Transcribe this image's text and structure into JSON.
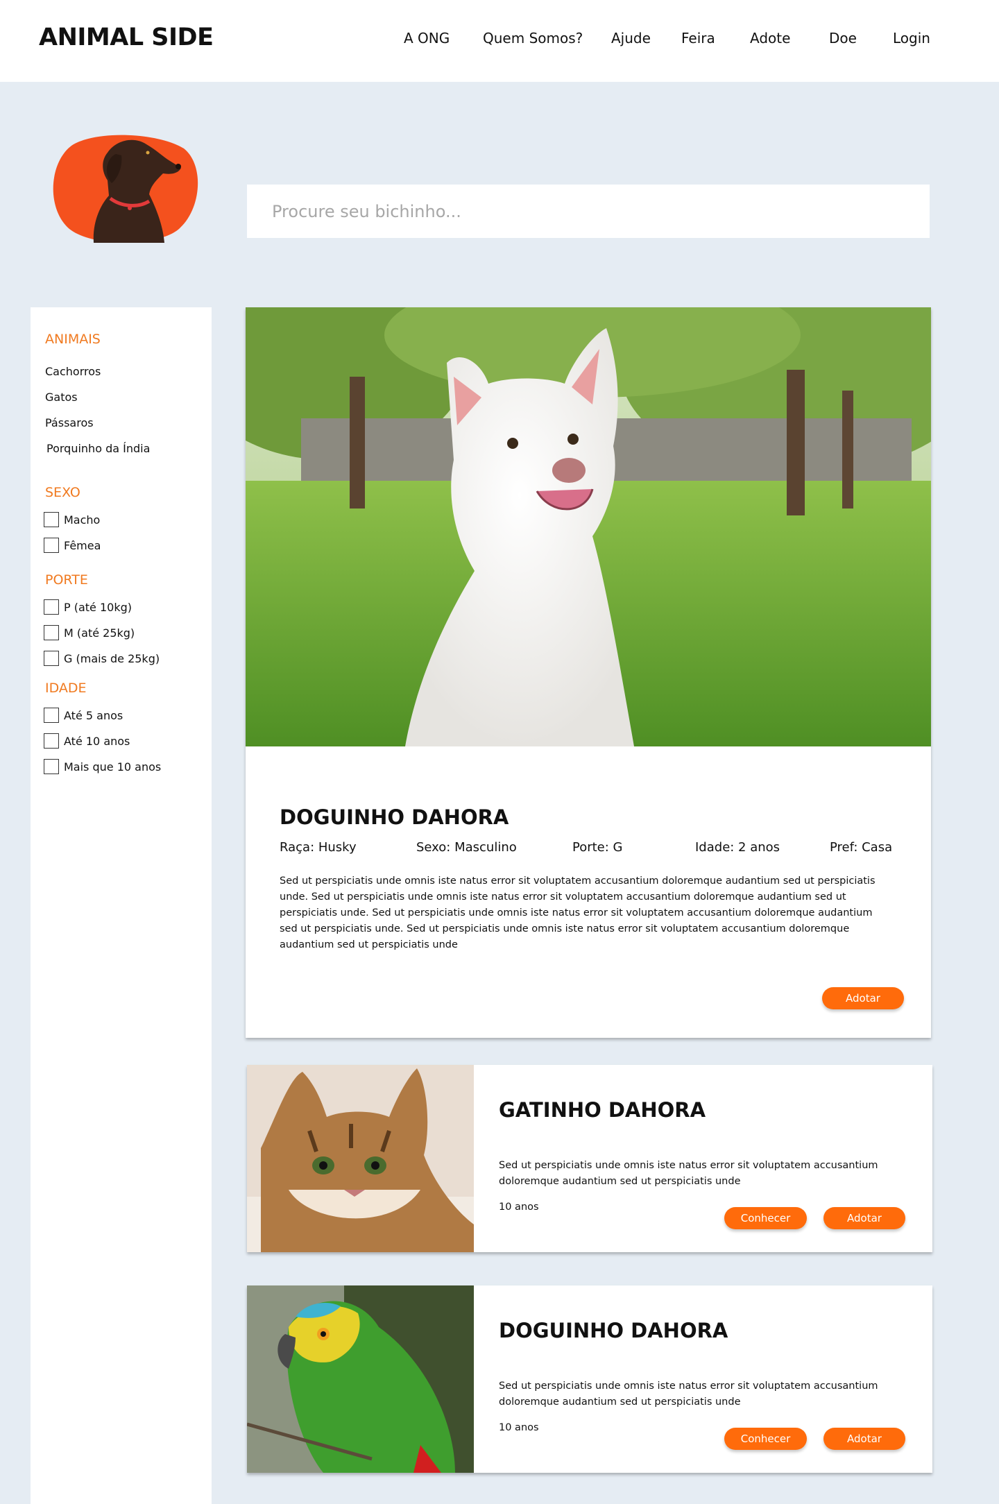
{
  "header": {
    "logo": "ANIMAL SIDE",
    "nav": [
      "A ONG",
      "Quem Somos?",
      "Ajude",
      "Feira",
      "Adote",
      "Doe",
      "Login"
    ]
  },
  "search": {
    "placeholder": "Procure seu bichinho..."
  },
  "sidebar": {
    "animais": {
      "title": "ANIMAIS",
      "items": [
        "Cachorros",
        "Gatos",
        "Pássaros",
        "Porquinho da Índia"
      ]
    },
    "sexo": {
      "title": "SEXO",
      "options": [
        "Macho",
        "Fêmea"
      ]
    },
    "porte": {
      "title": "PORTE",
      "options": [
        "P (até 10kg)",
        "M (até 25kg)",
        "G (mais de 25kg)"
      ]
    },
    "idade": {
      "title": "IDADE",
      "options": [
        "Até 5 anos",
        "Até 10 anos",
        "Mais que 10 anos"
      ]
    }
  },
  "featured": {
    "name": "DOGUINHO DAHORA",
    "raca": "Raça: Husky",
    "sexo": "Sexo: Masculino",
    "porte": "Porte: G",
    "idade": "Idade: 2 anos",
    "pref": "Pref: Casa",
    "description": "Sed ut perspiciatis unde omnis iste natus error sit voluptatem accusantium doloremque audantium sed ut perspiciatis unde. Sed ut perspiciatis unde omnis iste natus error sit voluptatem accusantium doloremque audantium sed ut perspiciatis unde. Sed ut perspiciatis unde omnis iste natus error sit voluptatem accusantium doloremque audantium sed ut perspiciatis unde. Sed ut perspiciatis unde omnis iste natus error sit voluptatem accusantium doloremque audantium sed ut perspiciatis unde",
    "adopt_label": "Adotar"
  },
  "cards": [
    {
      "name": "GATINHO DAHORA",
      "description": "Sed ut perspiciatis unde omnis iste natus error sit voluptatem accusantium doloremque audantium sed ut perspiciatis unde",
      "age": "10 anos",
      "know_label": "Conhecer",
      "adopt_label": "Adotar"
    },
    {
      "name": "DOGUINHO DAHORA",
      "description": "Sed ut perspiciatis unde omnis iste natus error sit voluptatem accusantium doloremque audantium sed ut perspiciatis unde",
      "age": "10 anos",
      "know_label": "Conhecer",
      "adopt_label": "Adotar"
    }
  ],
  "colors": {
    "accent": "#ff6b0b",
    "heading_accent": "#f07a20",
    "background": "#e5ecf3",
    "blob": "#f4511e"
  }
}
